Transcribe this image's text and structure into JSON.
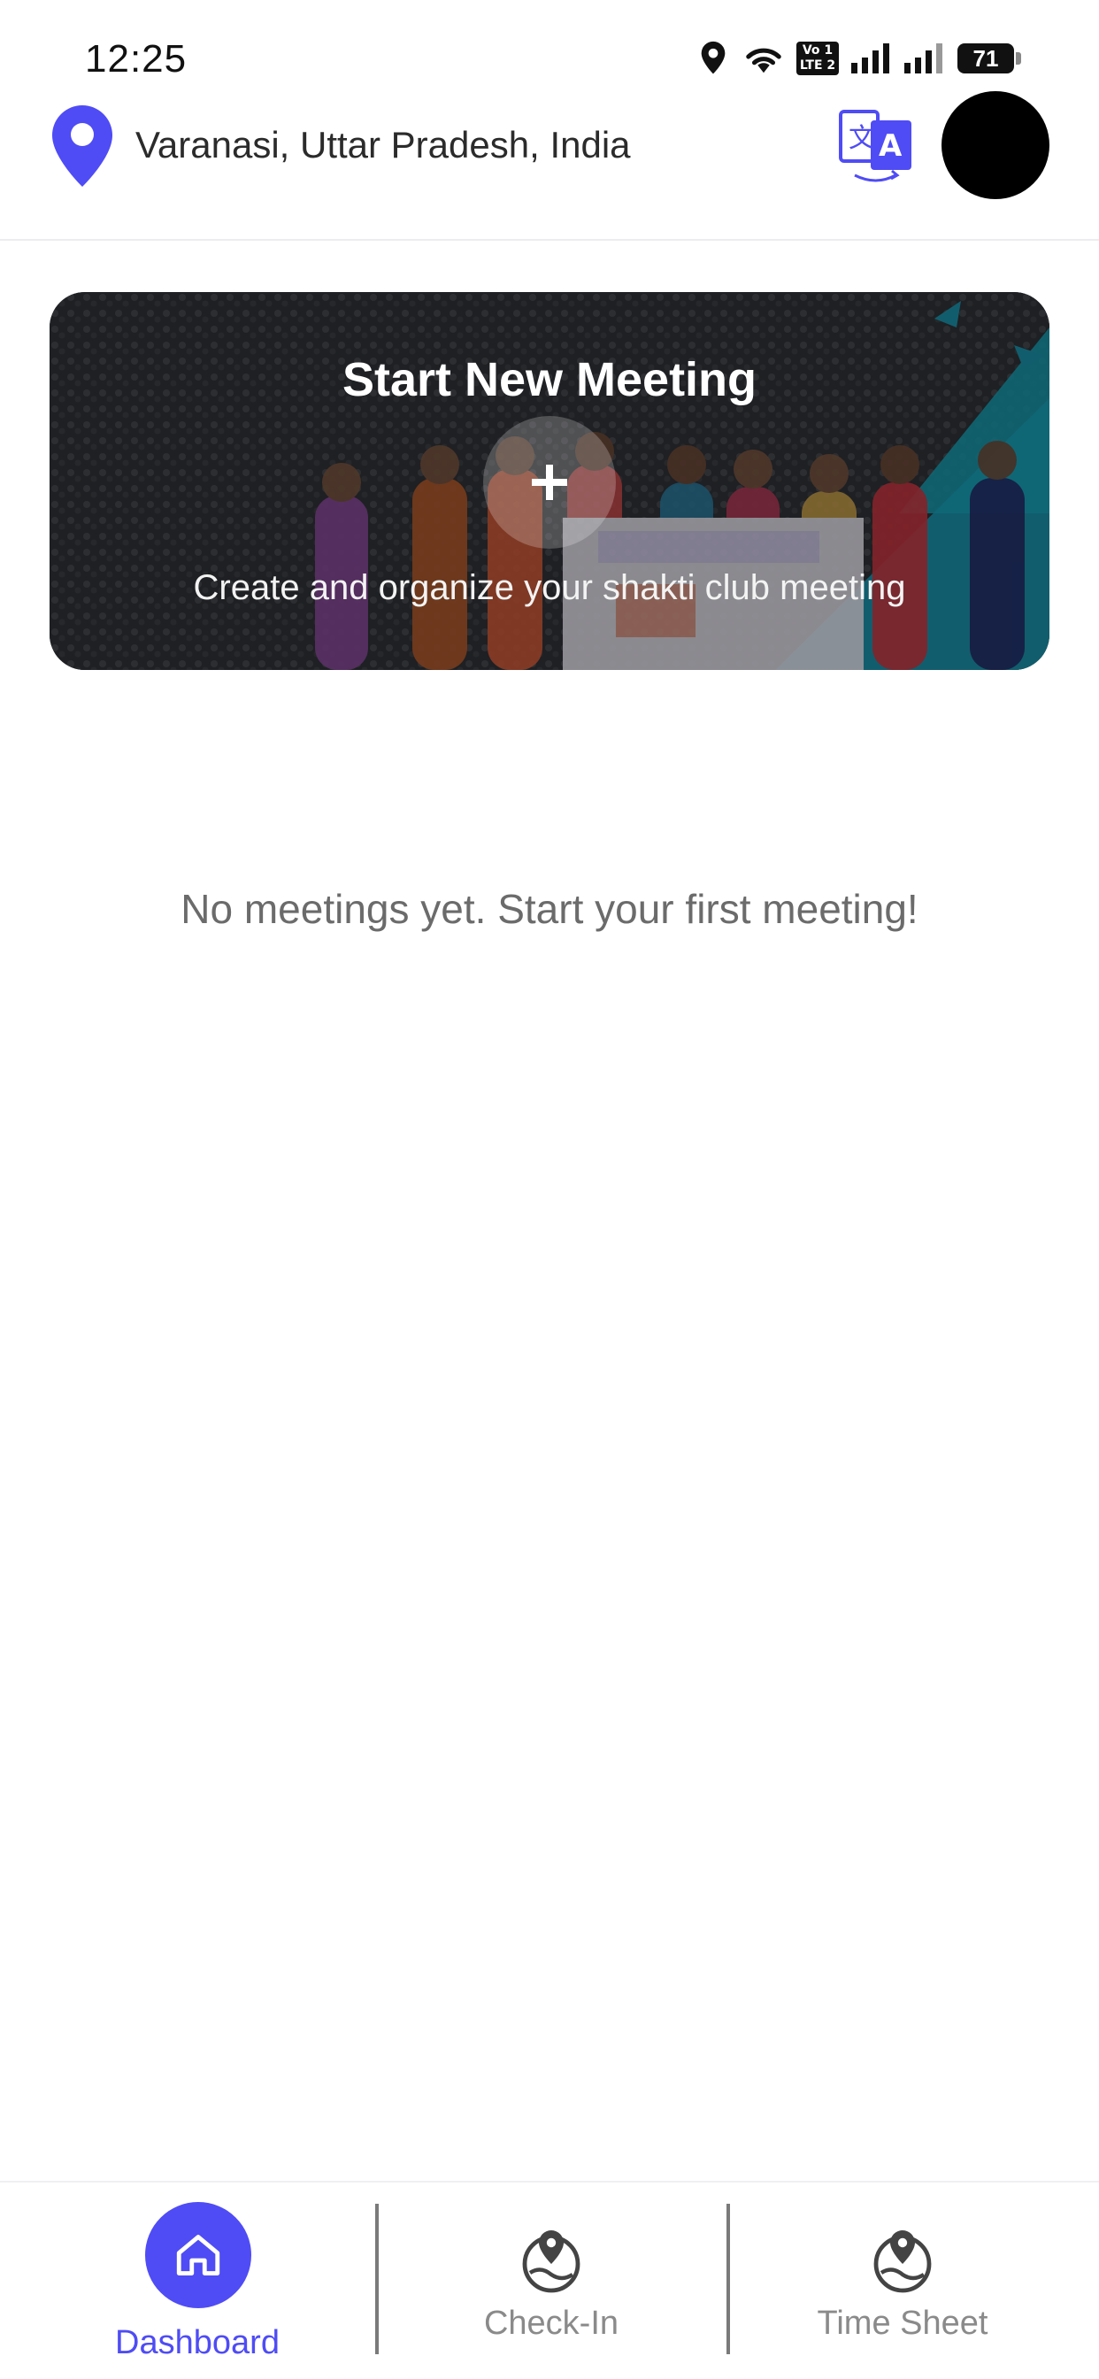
{
  "status_bar": {
    "time": "12:25",
    "battery": "71",
    "network_top": "Vo 1",
    "network_bottom": "LTE 2",
    "icons": [
      "location-icon",
      "wifi-icon",
      "volte-icon",
      "signal-icon",
      "signal-icon",
      "battery-icon"
    ]
  },
  "header": {
    "location": "Varanasi, Uttar Pradesh, India",
    "translate_icon": "translate-icon",
    "accent_color": "#4f4cf5"
  },
  "banner": {
    "title": "Start New Meeting",
    "subtitle": "Create and organize your shakti club meeting",
    "action_icon": "plus-icon"
  },
  "empty_state": {
    "message": "No meetings yet. Start your first meeting!"
  },
  "bottom_nav": {
    "items": [
      {
        "label": "Dashboard",
        "icon": "home-icon",
        "active": true
      },
      {
        "label": "Check-In",
        "icon": "map-pin-icon",
        "active": false
      },
      {
        "label": "Time Sheet",
        "icon": "map-pin-icon",
        "active": false
      }
    ],
    "active_color": "#4f4cf5"
  }
}
